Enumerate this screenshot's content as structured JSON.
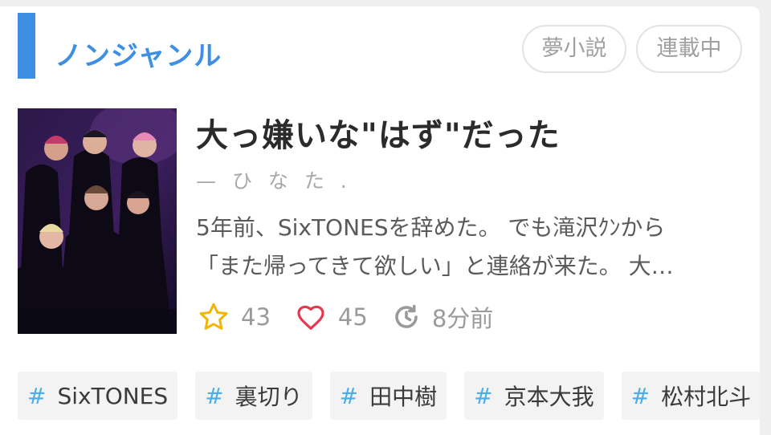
{
  "header": {
    "genre": "ノンジャンル",
    "tags": [
      "夢小説",
      "連載中"
    ]
  },
  "story": {
    "title": "大っ嫌いな\"はず\"だった",
    "author": "— ひ な た .",
    "description_line1": "5年前、SixTONESを辞めた。 でも滝沢ｸﾝから",
    "description_line2": "「また帰ってきて欲しい」と連絡が来た。 大…",
    "stars": "43",
    "likes": "45",
    "updated": "8分前"
  },
  "hashtags": [
    {
      "hash": "#",
      "label": "SixTONES"
    },
    {
      "hash": "#",
      "label": "裏切り"
    },
    {
      "hash": "#",
      "label": "田中樹"
    },
    {
      "hash": "#",
      "label": "京本大我"
    },
    {
      "hash": "#",
      "label": "松村北斗"
    }
  ],
  "icons": {
    "star": "star-icon",
    "heart": "heart-icon",
    "update": "update-clock-icon"
  },
  "colors": {
    "accent": "#3d8fe4",
    "star": "#f5b400",
    "heart": "#e8384f",
    "hash": "#4aaee9"
  }
}
